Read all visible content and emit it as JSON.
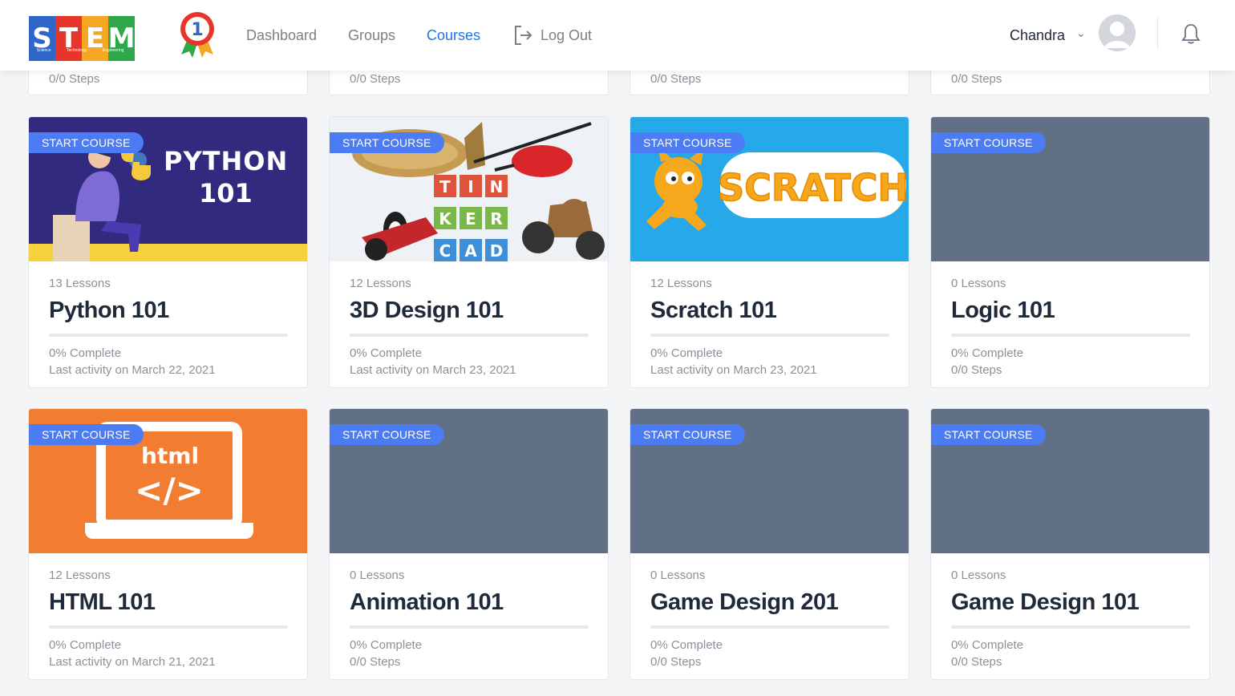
{
  "header": {
    "logo_letters": [
      "S",
      "T",
      "E",
      "M"
    ],
    "logo_caption": [
      "Science",
      "Technology",
      "Engineering",
      "Mathematics"
    ],
    "logo_badge": "1",
    "nav": [
      {
        "label": "Dashboard",
        "active": false
      },
      {
        "label": "Groups",
        "active": false
      },
      {
        "label": "Courses",
        "active": true
      },
      {
        "label": "Log Out",
        "active": false
      }
    ],
    "user_name": "Chandra"
  },
  "top_row": [
    {
      "steps": "0/0 Steps"
    },
    {
      "steps": "0/0 Steps"
    },
    {
      "steps": "0/0 Steps"
    },
    {
      "steps": "0/0 Steps"
    }
  ],
  "courses": [
    {
      "badge": "START COURSE",
      "lessons": "13 Lessons",
      "title": "Python 101",
      "progress": "0% Complete",
      "detail": "Last activity on March 22, 2021",
      "thumb": "python",
      "thumb_text": [
        "PYTHON",
        "101"
      ]
    },
    {
      "badge": "START COURSE",
      "lessons": "12 Lessons",
      "title": "3D Design 101",
      "progress": "0% Complete",
      "detail": "Last activity on March 23, 2021",
      "thumb": "tinkercad",
      "thumb_text": [
        "T",
        "I",
        "N",
        "K",
        "E",
        "R",
        "C",
        "A",
        "D"
      ]
    },
    {
      "badge": "START COURSE",
      "lessons": "12 Lessons",
      "title": "Scratch 101",
      "progress": "0% Complete",
      "detail": "Last activity on March 23, 2021",
      "thumb": "scratch",
      "thumb_text": [
        "SCRATCH"
      ]
    },
    {
      "badge": "START COURSE",
      "lessons": "0 Lessons",
      "title": "Logic 101",
      "progress": "0% Complete",
      "detail": "0/0 Steps",
      "thumb": "blank",
      "thumb_text": []
    },
    {
      "badge": "START COURSE",
      "lessons": "12 Lessons",
      "title": "HTML 101",
      "progress": "0% Complete",
      "detail": "Last activity on March 21, 2021",
      "thumb": "html",
      "thumb_text": [
        "html",
        "</>"
      ]
    },
    {
      "badge": "START COURSE",
      "lessons": "0 Lessons",
      "title": "Animation 101",
      "progress": "0% Complete",
      "detail": "0/0 Steps",
      "thumb": "blank",
      "thumb_text": []
    },
    {
      "badge": "START COURSE",
      "lessons": "0 Lessons",
      "title": "Game Design 201",
      "progress": "0% Complete",
      "detail": "0/0 Steps",
      "thumb": "blank",
      "thumb_text": []
    },
    {
      "badge": "START COURSE",
      "lessons": "0 Lessons",
      "title": "Game Design 101",
      "progress": "0% Complete",
      "detail": "0/0 Steps",
      "thumb": "blank",
      "thumb_text": []
    }
  ],
  "colors": {
    "accent": "#1e76e8",
    "badge": "#4b7cf3",
    "python_bg": "#322a7e",
    "python_stripe": "#f7d13b",
    "scratch_bg": "#27a9e9",
    "html_bg": "#f37c33",
    "blank_bg": "#617084"
  }
}
